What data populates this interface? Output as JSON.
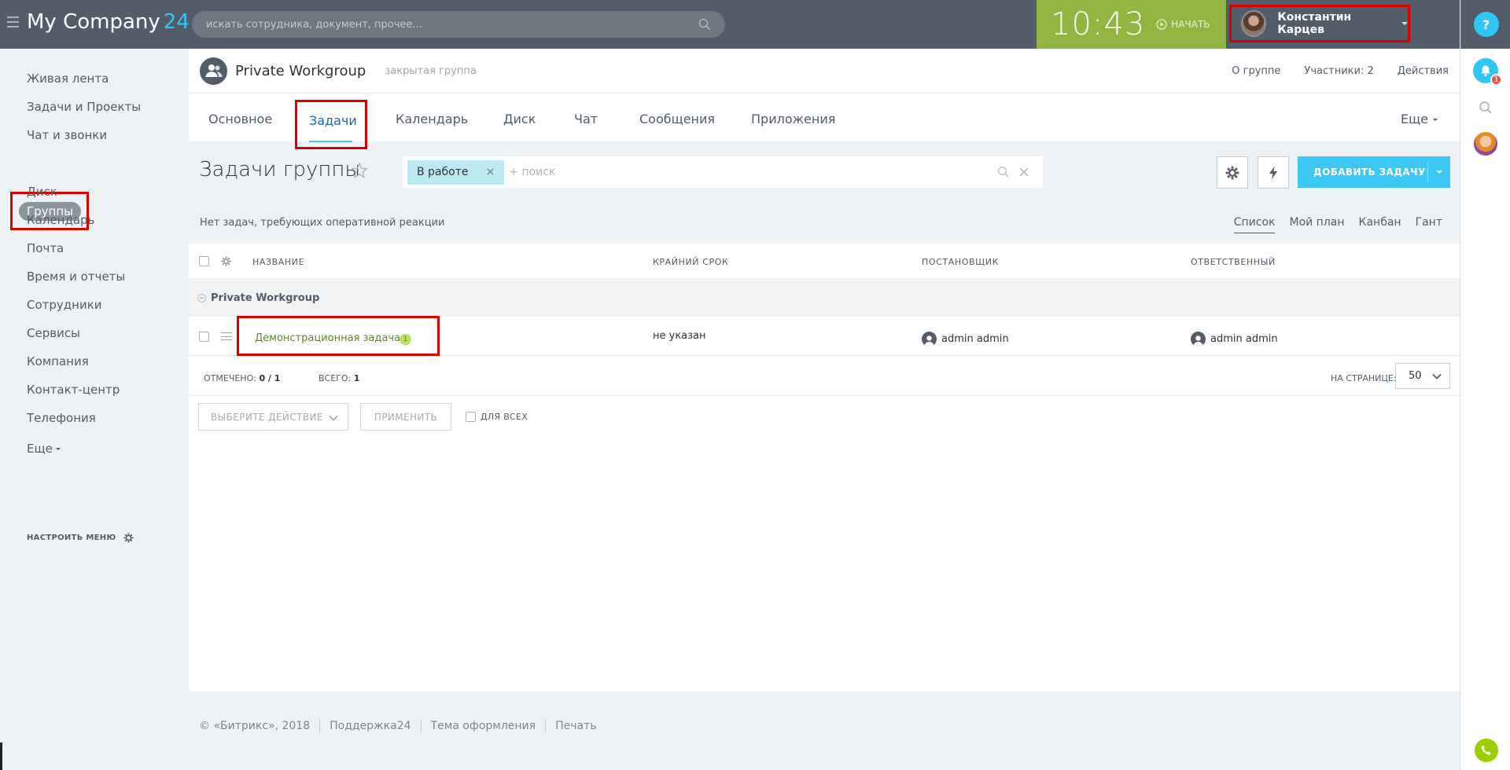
{
  "topbar": {
    "logo": "My Company",
    "logo_num": "24",
    "search_placeholder": "искать сотрудника, документ, прочее...",
    "clock": "10:43",
    "start_label": "НАЧАТЬ",
    "user_name": "Константин Карцев",
    "help": "?"
  },
  "right_panel": {
    "notification_count": "1"
  },
  "leftnav": {
    "items": [
      "Живая лента",
      "Задачи и Проекты",
      "Чат и звонки",
      "Группы",
      "Диск",
      "Календарь",
      "Почта",
      "Время и отчеты",
      "Сотрудники",
      "Сервисы",
      "Компания",
      "Контакт-центр",
      "Телефония",
      "Еще"
    ],
    "settings_label": "НАСТРОИТЬ МЕНЮ"
  },
  "group": {
    "title": "Private Workgroup",
    "subtitle": "закрытая группа",
    "actions": [
      "О группе",
      "Участники: 2",
      "Действия"
    ]
  },
  "tabs": {
    "items": [
      "Основное",
      "Задачи",
      "Календарь",
      "Диск",
      "Чат",
      "Сообщения",
      "Приложения"
    ],
    "more": "Еще",
    "active": "Задачи"
  },
  "tasks": {
    "page_title": "Задачи группы",
    "filter_chip": "В работе",
    "filter_placeholder": "+ поиск",
    "add_button": "ДОБАВИТЬ ЗАДАЧУ",
    "notice": "Нет задач, требующих оперативной реакции",
    "views": [
      "Список",
      "Мой план",
      "Канбан",
      "Гант"
    ],
    "columns": [
      "НАЗВАНИЕ",
      "КРАЙНИЙ СРОК",
      "ПОСТАНОВЩИК",
      "ОТВЕТСТВЕННЫЙ"
    ],
    "group_name": "Private Workgroup",
    "rows": [
      {
        "name": "Демонстрационная задача",
        "badge": "1",
        "deadline": "не указан",
        "creator": "admin admin",
        "responsible": "admin admin"
      }
    ],
    "marked_label": "ОТМЕЧЕНО:",
    "marked_value": "0 / 1",
    "total_label": "ВСЕГО:",
    "total_value": "1",
    "per_page_label": "НА СТРАНИЦЕ:",
    "per_page_value": "50",
    "action_select": "ВЫБЕРИТЕ ДЕЙСТВИЕ",
    "apply": "ПРИМЕНИТЬ",
    "for_all": "ДЛЯ ВСЕХ"
  },
  "footer": {
    "items": [
      "© «Битрикс», 2018",
      "Поддержка24",
      "Тема оформления",
      "Печать"
    ]
  },
  "colors": {
    "topbar": "#535c69",
    "accent": "#2fc6f6",
    "timebar": "#92b440",
    "highlight": "#d80000",
    "task_link": "#5c8a1f"
  }
}
